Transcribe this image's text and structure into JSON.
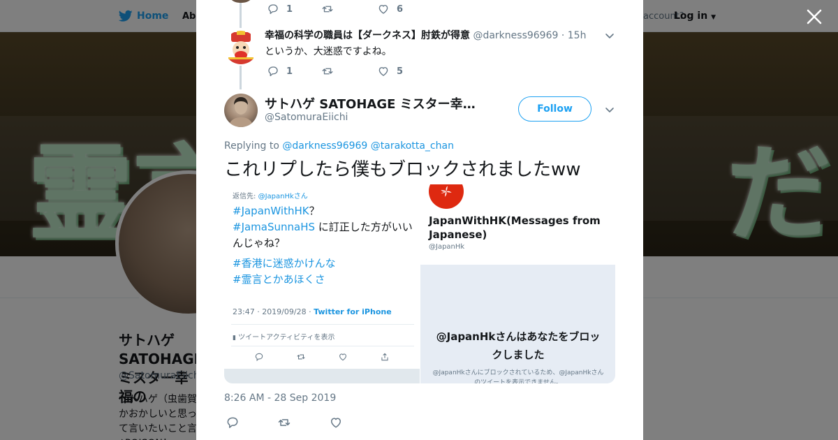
{
  "topbar": {
    "home_label": "Home",
    "about_label": "Abo",
    "account_prompt": "account?",
    "login_label": "Log in"
  },
  "profile": {
    "name": "サトハゲ SATOHAGE ミスター幸福の",
    "handle": "@SatomuraEiichi",
    "bio": "サトハゲ（虫歯賀 かおかしいと思っ て言いたいこと言 ♪POISON！",
    "banner_text_left": "霊言",
    "banner_text_right": "だ"
  },
  "modal": {
    "close_icon": "close-icon"
  },
  "thread": {
    "prev_tweet": {
      "reply_count": "1",
      "like_count": "6"
    },
    "reply": {
      "name": "幸福の科学の職員は【ダークネス】肘鉄が得意",
      "handle": "@darkness96969",
      "time": "· 15h",
      "text": "というか、大迷惑ですよね。",
      "reply_count": "1",
      "like_count": "5"
    }
  },
  "main_tweet": {
    "name": "サトハゲ SATOHAGE ミスター幸福...",
    "handle": "@SatomuraEiichi",
    "follow_label": "Follow",
    "replying_prefix": "Replying to",
    "replying_to_1": "@darkness96969",
    "replying_to_2": "@tarakotta_chan",
    "text": "これリプしたら僕もブロックされましたww",
    "timestamp": "8:26 AM - 28 Sep 2019"
  },
  "attached_image_1": {
    "reply_prefix": "返信先: ",
    "reply_mention": "@JapanHkさん",
    "line1_hashtag": "#JapanWithHK",
    "line1_suffix": "？",
    "line2_hashtag": "#JamaSunnaHS",
    "line2_suffix": " に訂正した方がいいんじゃね？",
    "line3_hashtag": "#香港に迷惑かけんな",
    "line4_hashtag": "#霊言とかあほくさ",
    "stamp": "23:47 · 2019/09/28 · ",
    "stamp_source": "Twitter for iPhone",
    "activity": "ツイートアクティビティを表示"
  },
  "attached_image_2": {
    "account_name": "JapanWithHK(Messages from Japanese)",
    "account_handle": "@JapanHk",
    "block_title": "@JapanHkさんはあなたをブロックしました",
    "block_sub": "@JapanHkさんにブロックされているため、@JapanHkさんのツイートを表示できません。"
  },
  "colors": {
    "accent": "#1da1f2",
    "mention": "#1b95e0",
    "secondary_text": "#657786",
    "primary_text": "#14171a"
  }
}
